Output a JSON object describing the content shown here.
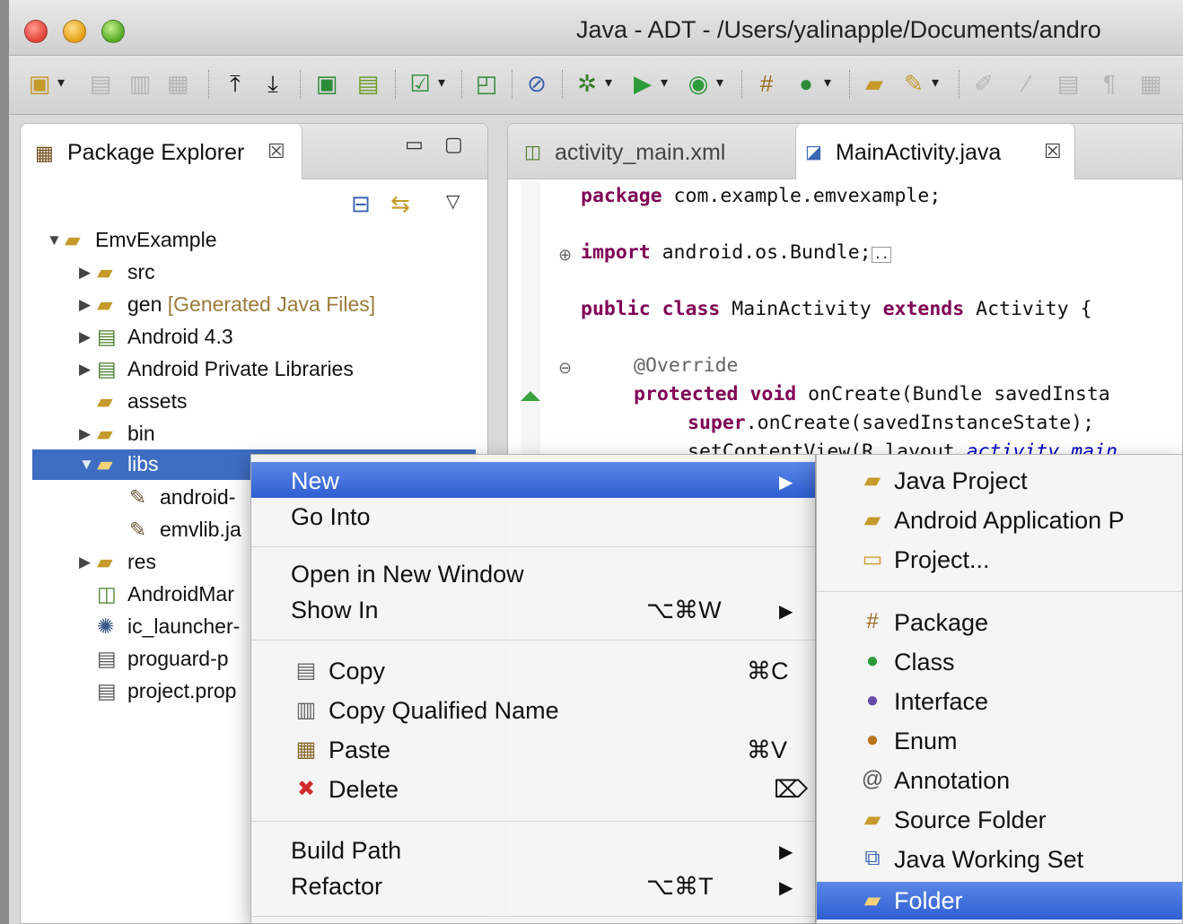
{
  "window": {
    "title": "Java - ADT - /Users/yalinapple/Documents/andro"
  },
  "toolbar": {
    "icons": [
      "new-wizard",
      "save",
      "save-all",
      "print",
      "export",
      "import",
      "new-android-project",
      "android-virtual-device",
      "open-type",
      "new-java-class",
      "skip-breakpoints",
      "debug",
      "run",
      "run-external-tool",
      "new-package",
      "new-class",
      "open-project",
      "search",
      "toggle-mark-occurrences",
      "annotations",
      "show-whitespace",
      "block-selection"
    ]
  },
  "package_explorer": {
    "tab_label": "Package Explorer",
    "tree": [
      {
        "label": "EmvExample",
        "decoration": "",
        "icon": "android-project-icon",
        "expanded": true
      },
      {
        "label": "src",
        "decoration": "",
        "icon": "source-folder-icon",
        "expanded": false
      },
      {
        "label": "gen",
        "decoration": "[Generated Java Files]",
        "icon": "generated-source-folder-icon",
        "expanded": false
      },
      {
        "label": "Android 4.3",
        "decoration": "",
        "icon": "library-icon",
        "expanded": false
      },
      {
        "label": "Android Private Libraries",
        "decoration": "",
        "icon": "library-icon",
        "expanded": false
      },
      {
        "label": "assets",
        "decoration": "",
        "icon": "folder-icon",
        "expanded": null
      },
      {
        "label": "bin",
        "decoration": "",
        "icon": "folder-icon",
        "expanded": false
      },
      {
        "label": "libs",
        "decoration": "",
        "icon": "folder-icon",
        "expanded": true,
        "selected": true
      },
      {
        "label": "android-",
        "decoration": "",
        "icon": "jar-icon",
        "expanded": null
      },
      {
        "label": "emvlib.ja",
        "decoration": "",
        "icon": "jar-icon",
        "expanded": null
      },
      {
        "label": "res",
        "decoration": "",
        "icon": "folder-icon",
        "expanded": false
      },
      {
        "label": "AndroidMar",
        "decoration": "",
        "icon": "xml-file-icon",
        "expanded": null
      },
      {
        "label": "ic_launcher-",
        "decoration": "",
        "icon": "image-file-icon",
        "expanded": null
      },
      {
        "label": "proguard-p",
        "decoration": "",
        "icon": "text-file-icon",
        "expanded": null
      },
      {
        "label": "project.prop",
        "decoration": "",
        "icon": "text-file-icon",
        "expanded": null
      }
    ]
  },
  "editor": {
    "tabs": [
      {
        "label": "activity_main.xml",
        "active": false
      },
      {
        "label": "MainActivity.java",
        "active": true
      }
    ],
    "code": {
      "l1": "package",
      "l1b": " com.example.emvexample;",
      "l2": "import",
      "l2b": " android.os.Bundle;",
      "l3a": "public",
      "l3b": "class",
      "l3c": " MainActivity ",
      "l3d": "extends",
      "l3e": " Activity {",
      "l4": "@Override",
      "l5a": "protected",
      "l5b": "void",
      "l5c": " onCreate(Bundle savedInsta",
      "l6a": "super",
      "l6b": ".onCreate(savedInstanceState);",
      "l7a": "setContentView(R.layout.",
      "l7b": "activity_main"
    }
  },
  "context_menu": {
    "new": "New",
    "go_into": "Go Into",
    "open_new_window": "Open in New Window",
    "show_in": "Show In",
    "show_in_shortcut": "⌥⌘W",
    "copy": "Copy",
    "copy_shortcut": "⌘C",
    "copy_qualified": "Copy Qualified Name",
    "paste": "Paste",
    "paste_shortcut": "⌘V",
    "delete": "Delete",
    "delete_shortcut": "⌦",
    "build_path": "Build Path",
    "refactor": "Refactor",
    "refactor_shortcut": "⌥⌘T"
  },
  "submenu": {
    "items": [
      {
        "label": "Java Project",
        "icon": "java-project-icon"
      },
      {
        "label": "Android Application P",
        "icon": "android-project-icon"
      },
      {
        "label": "Project...",
        "icon": "project-icon"
      },
      {
        "label": "Package",
        "icon": "package-icon"
      },
      {
        "label": "Class",
        "icon": "class-icon"
      },
      {
        "label": "Interface",
        "icon": "interface-icon"
      },
      {
        "label": "Enum",
        "icon": "enum-icon"
      },
      {
        "label": "Annotation",
        "icon": "annotation-icon"
      },
      {
        "label": "Source Folder",
        "icon": "source-folder-icon"
      },
      {
        "label": "Java Working Set",
        "icon": "working-set-icon"
      },
      {
        "label": "Folder",
        "icon": "folder-icon",
        "highlighted": true
      }
    ]
  },
  "colors": {
    "selection": "#3e6dc2",
    "menu_highlight": "#2f5fd4",
    "keyword": "#7f0055",
    "annotation": "#646464"
  }
}
